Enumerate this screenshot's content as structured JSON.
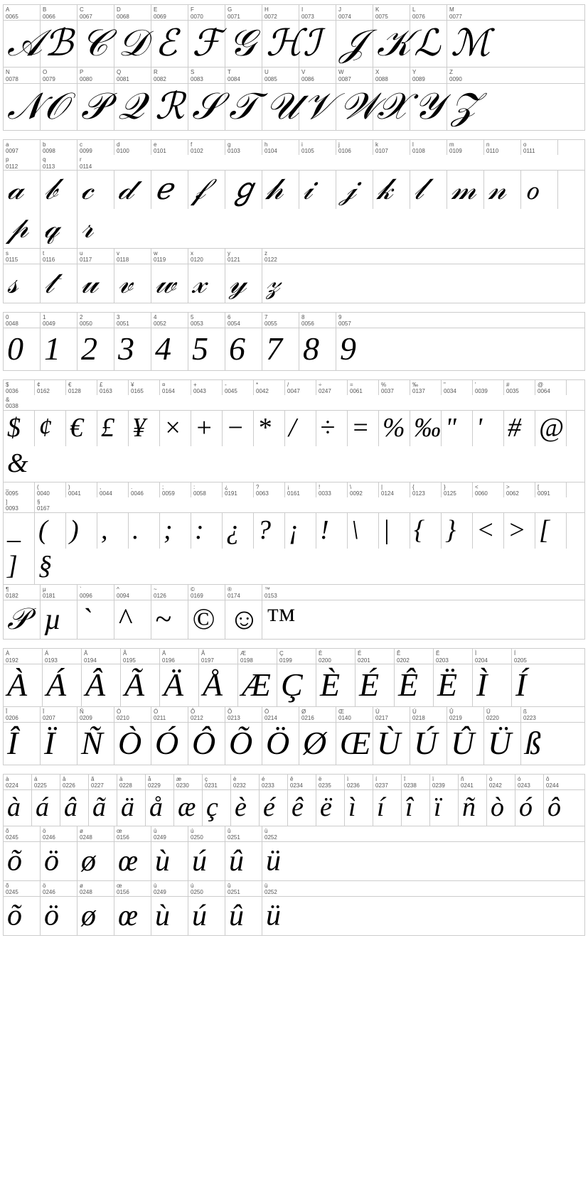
{
  "sections": {
    "uppercase_row1": {
      "labels": [
        "A",
        "B",
        "C",
        "D",
        "E",
        "F",
        "G",
        "H",
        "I",
        "J",
        "K",
        "L",
        "M"
      ],
      "codes": [
        "0065",
        "0066",
        "0067",
        "0068",
        "0069",
        "0070",
        "0071",
        "0072",
        "0073",
        "0074",
        "0075",
        "0076",
        "0077"
      ],
      "glyphs": [
        "𝒜",
        "ℬ",
        "𝒞",
        "𝒟",
        "ℰ",
        "ℱ",
        "𝒢",
        "ℋ",
        "ℐ",
        "𝒥",
        "𝒦",
        "ℒ",
        "ℳ"
      ]
    },
    "uppercase_row2": {
      "labels": [
        "N",
        "O",
        "P",
        "Q",
        "R",
        "S",
        "T",
        "U",
        "V",
        "W",
        "X",
        "Y",
        "Z"
      ],
      "codes": [
        "0078",
        "0079",
        "0080",
        "0081",
        "0082",
        "0083",
        "0084",
        "0085",
        "0086",
        "0087",
        "0088",
        "0089",
        "0090"
      ],
      "glyphs": [
        "𝒩",
        "𝒪",
        "𝒫",
        "𝒬",
        "ℛ",
        "𝒮",
        "𝒯",
        "𝒰",
        "𝒱",
        "𝒲",
        "𝒳",
        "𝒴",
        "𝒵"
      ]
    },
    "lowercase_row1": {
      "labels": [
        "a",
        "b",
        "c",
        "d",
        "e",
        "f",
        "g",
        "h",
        "i",
        "j",
        "k",
        "l",
        "m",
        "n",
        "o",
        "p",
        "q",
        "r"
      ],
      "codes": [
        "0097",
        "0098",
        "0099",
        "0100",
        "0101",
        "0102",
        "0103",
        "0104",
        "0105",
        "0106",
        "0107",
        "0108",
        "0109",
        "0110",
        "0111",
        "0112",
        "0113",
        "0114"
      ],
      "glyphs": [
        "𝒶",
        "𝒷",
        "𝒸",
        "𝒹",
        "ℯ",
        "𝒻",
        "ℊ",
        "𝒽",
        "𝒾",
        "𝒿",
        "𝓀",
        "𝓁",
        "𝓂",
        "𝓃",
        "ℴ",
        "𝓅",
        "𝓆",
        "𝓇"
      ]
    },
    "lowercase_row2": {
      "labels": [
        "s",
        "t",
        "u",
        "v",
        "w",
        "x",
        "y",
        "z"
      ],
      "codes": [
        "0115",
        "0116",
        "0117",
        "0118",
        "0119",
        "0120",
        "0121",
        "0122"
      ],
      "glyphs": [
        "𝓈",
        "𝓉",
        "𝓊",
        "𝓋",
        "𝓌",
        "𝓍",
        "𝓎",
        "𝓏"
      ]
    },
    "numbers": {
      "labels": [
        "0",
        "1",
        "2",
        "3",
        "4",
        "5",
        "6",
        "7",
        "8",
        "9"
      ],
      "codes": [
        "0048",
        "0049",
        "0050",
        "0051",
        "0052",
        "0053",
        "0054",
        "0055",
        "0056",
        "0057"
      ],
      "glyphs": [
        "0",
        "1",
        "2",
        "3",
        "4",
        "5",
        "6",
        "7",
        "8",
        "9"
      ]
    },
    "symbols_row1": {
      "labels": [
        "$",
        "¢",
        "€",
        "£",
        "¥",
        "¤",
        "+",
        "-",
        "*",
        "/",
        "÷",
        "=",
        "%",
        "‰",
        "\"",
        "'",
        "#",
        "@",
        "&"
      ],
      "codes": [
        "0036",
        "0162",
        "0128",
        "0163",
        "0165",
        "0164",
        "0043",
        "0045",
        "0042",
        "0047",
        "0247",
        "0061",
        "0037",
        "0137",
        "0034",
        "0039",
        "0035",
        "0064",
        "0038"
      ],
      "glyphs": [
        "$",
        "¢",
        "€",
        "£",
        "¥",
        "¤",
        "+",
        "−",
        "∗",
        "/",
        "÷",
        "=",
        "%",
        "‰",
        "\"",
        "'",
        "#",
        "@",
        "&"
      ]
    },
    "symbols_row2": {
      "labels": [
        "_",
        "(",
        ")",
        ",",
        ".",
        ":",
        ";",
        "¿",
        "?",
        "¡",
        "!",
        "\\",
        "|",
        "[",
        "{",
        "}",
        "<",
        ">",
        "[",
        "]",
        "§"
      ],
      "codes": [
        "0095",
        "0040",
        "0041",
        "0044",
        "0046",
        "0059",
        "0058",
        "0191",
        "0063",
        "0161",
        "0033",
        "0092",
        "0124",
        "0123",
        "0125",
        "0060",
        "0062",
        "0091",
        "0093",
        "0167"
      ],
      "glyphs": [
        "_",
        "(",
        ")",
        ",",
        ".",
        ":",
        ";",
        "¿",
        "?",
        "¡",
        "!",
        "\\",
        "|",
        "[",
        "{",
        "}",
        "<",
        ">",
        "[",
        "]",
        "§"
      ]
    },
    "symbols_row3": {
      "labels": [
        "¶",
        "µ",
        "`",
        "^",
        "~",
        "©",
        "®",
        "™"
      ],
      "codes": [
        "0182",
        "0181",
        "0096",
        "0094",
        "0126",
        "0169",
        "0174",
        "0153"
      ],
      "glyphs": [
        "¶",
        "µ",
        "`",
        "^",
        "~",
        "©",
        "®",
        "™"
      ]
    },
    "accented_upper_row1": {
      "labels": [
        "À",
        "Á",
        "Â",
        "Ã",
        "Ä",
        "Å",
        "Æ",
        "Ç",
        "È",
        "É",
        "Ê",
        "Ë",
        "Ì",
        "Í"
      ],
      "codes": [
        "0192",
        "0193",
        "0194",
        "0195",
        "0196",
        "0197",
        "0198",
        "0199",
        "0200",
        "0201",
        "0202",
        "0203",
        "0204",
        "0205"
      ],
      "glyphs": [
        "À",
        "Á",
        "Â",
        "Ã",
        "Ä",
        "Å",
        "Æ",
        "Ç",
        "È",
        "É",
        "Ê",
        "Ë",
        "Ì",
        "Í"
      ]
    },
    "accented_upper_row2": {
      "labels": [
        "Î",
        "Ï",
        "Ñ",
        "Ò",
        "Ó",
        "Ô",
        "Õ",
        "Ö",
        "Ø",
        "Œ",
        "Ù",
        "Ú",
        "Û",
        "Ü",
        "ß"
      ],
      "codes": [
        "0206",
        "0207",
        "0209",
        "0210",
        "0211",
        "0212",
        "0213",
        "0214",
        "0216",
        "0140",
        "0217",
        "0218",
        "0219",
        "0220",
        "0223"
      ],
      "glyphs": [
        "Î",
        "Ï",
        "Ñ",
        "Ò",
        "Ó",
        "Ô",
        "Õ",
        "Ö",
        "Ø",
        "Œ",
        "Ù",
        "Ú",
        "Û",
        "Ü",
        "ß"
      ]
    },
    "accented_lower_row1": {
      "labels": [
        "à",
        "á",
        "â",
        "ã",
        "ä",
        "å",
        "æ",
        "ç",
        "è",
        "é",
        "ê",
        "ë",
        "ì",
        "í",
        "î",
        "ï",
        "ñ",
        "ò",
        "ó",
        "ô"
      ],
      "codes": [
        "0224",
        "0225",
        "0226",
        "0227",
        "0228",
        "0229",
        "0230",
        "0231",
        "0232",
        "0233",
        "0234",
        "0235",
        "0236",
        "0237",
        "0238",
        "0239",
        "0241",
        "0242",
        "0243",
        "0244"
      ],
      "glyphs": [
        "à",
        "á",
        "â",
        "ã",
        "ä",
        "å",
        "æ",
        "ç",
        "è",
        "é",
        "ê",
        "ë",
        "ì",
        "í",
        "î",
        "ï",
        "ñ",
        "ò",
        "ó",
        "ô"
      ]
    },
    "accented_lower_row2": {
      "labels": [
        "õ",
        "ö",
        "ø",
        "œ",
        "ù",
        "ú",
        "û",
        "ü"
      ],
      "codes": [
        "0245",
        "0246",
        "0248",
        "0156",
        "0249",
        "0250",
        "0251",
        "0252"
      ],
      "glyphs": [
        "õ",
        "ö",
        "ø",
        "œ",
        "ù",
        "ú",
        "û",
        "ü"
      ]
    },
    "accented_lower_row3": {
      "labels": [
        "õ",
        "ö",
        "ø",
        "œ",
        "ù",
        "ú",
        "û",
        "ü"
      ],
      "codes": [
        "0245",
        "0246",
        "0248",
        "0156",
        "0249",
        "0250",
        "0251",
        "0252"
      ],
      "glyphs": [
        "õ",
        "ö",
        "ø",
        "œ",
        "ù",
        "ú",
        "û",
        "ü"
      ]
    }
  }
}
